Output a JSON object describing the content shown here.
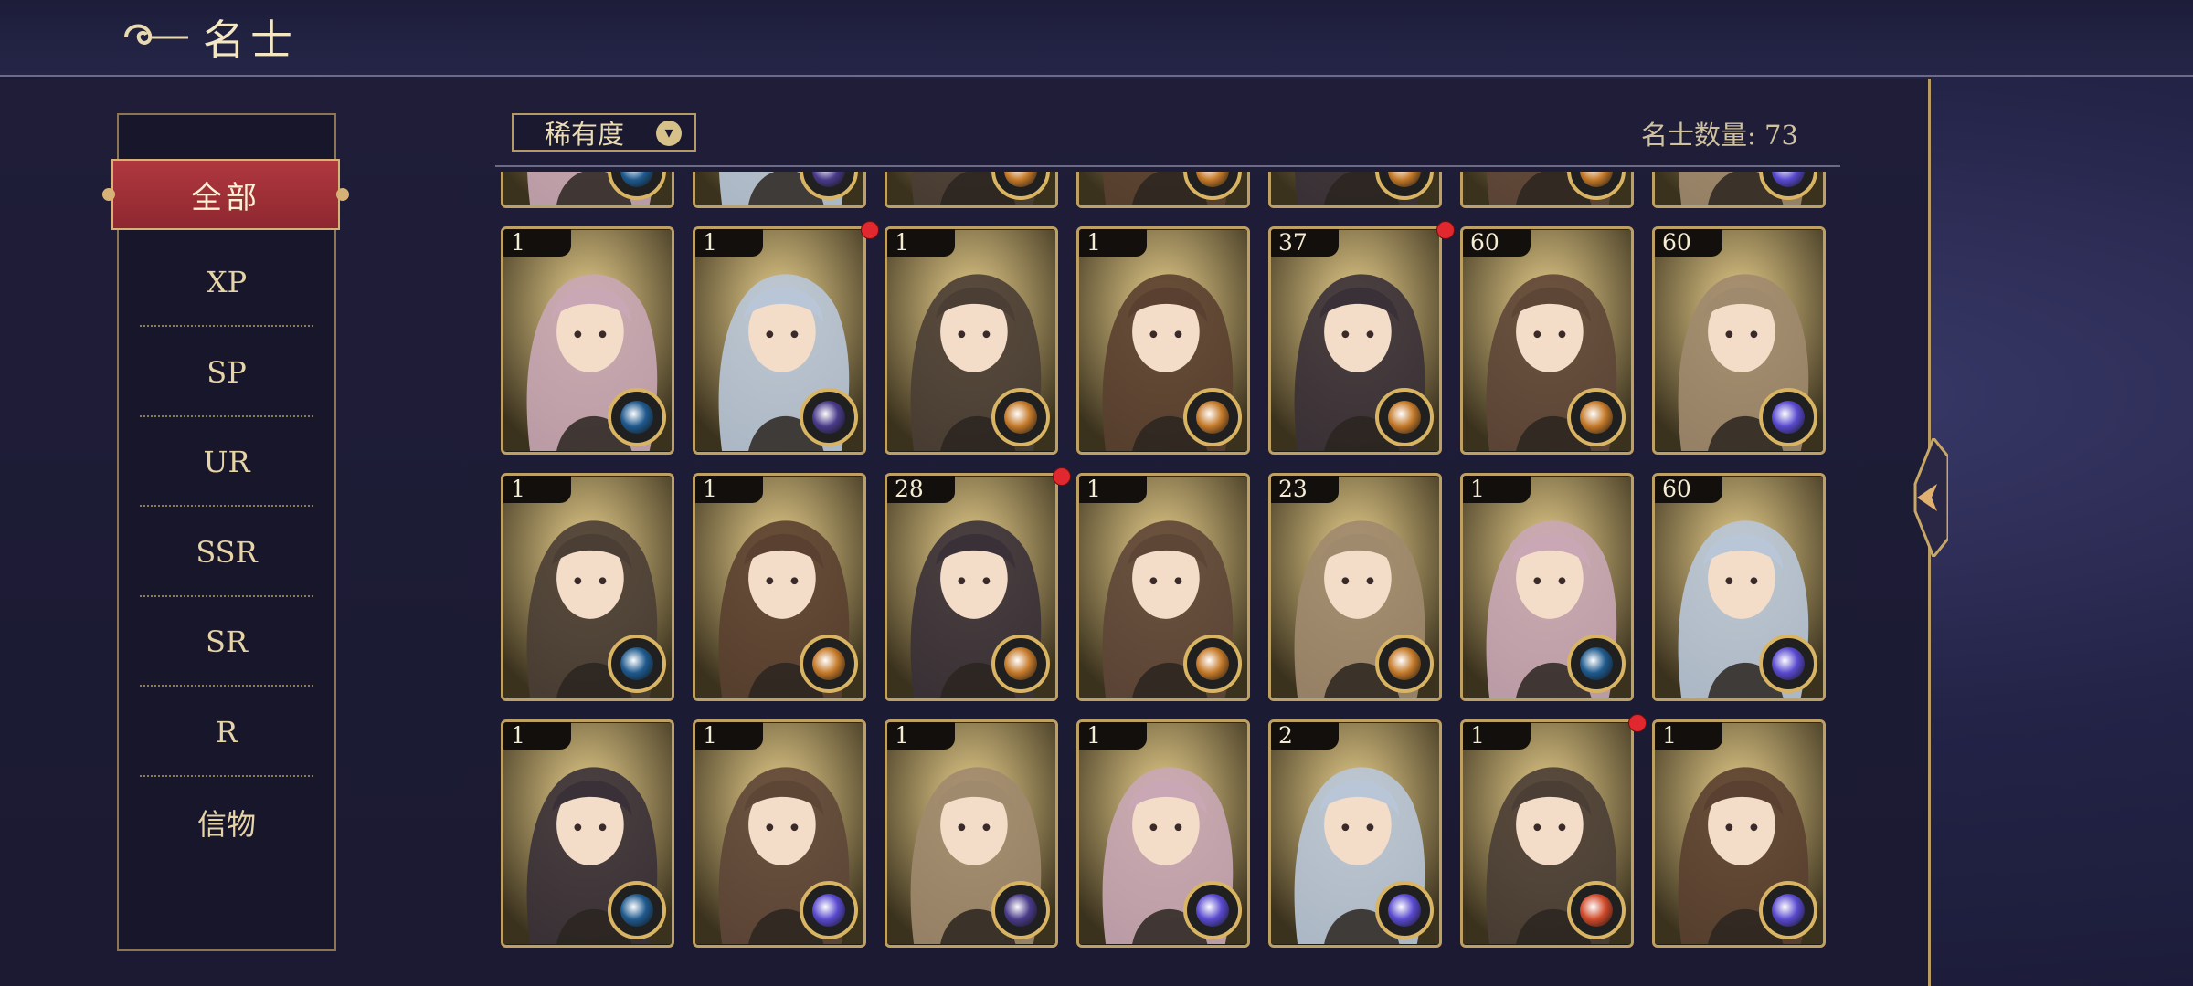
{
  "header": {
    "title": "名士"
  },
  "sidebar": {
    "active": "全部",
    "items": [
      "XP",
      "SP",
      "UR",
      "SSR",
      "SR",
      "R",
      "信物"
    ]
  },
  "filter": {
    "label": "稀有度"
  },
  "count_text": "名士数量: 73",
  "rows": [
    [
      {
        "level": "1",
        "emblem": "blue",
        "dot": false
      },
      {
        "level": "1",
        "emblem": "purple",
        "dot": true
      },
      {
        "level": "1",
        "emblem": "orange",
        "dot": false
      },
      {
        "level": "1",
        "emblem": "orange",
        "dot": false
      },
      {
        "level": "37",
        "emblem": "orange",
        "dot": true
      },
      {
        "level": "60",
        "emblem": "orange",
        "dot": false
      },
      {
        "level": "60",
        "emblem": "galaxy",
        "dot": false
      }
    ],
    [
      {
        "level": "1",
        "emblem": "blue",
        "dot": false
      },
      {
        "level": "1",
        "emblem": "orange",
        "dot": false
      },
      {
        "level": "28",
        "emblem": "orange",
        "dot": true
      },
      {
        "level": "1",
        "emblem": "orange",
        "dot": false
      },
      {
        "level": "23",
        "emblem": "orange",
        "dot": false
      },
      {
        "level": "1",
        "emblem": "blue",
        "dot": false
      },
      {
        "level": "60",
        "emblem": "galaxy",
        "dot": false
      }
    ],
    [
      {
        "level": "1",
        "emblem": "blue",
        "dot": false
      },
      {
        "level": "1",
        "emblem": "galaxy",
        "dot": false
      },
      {
        "level": "1",
        "emblem": "purple",
        "dot": false
      },
      {
        "level": "1",
        "emblem": "galaxy",
        "dot": false
      },
      {
        "level": "2",
        "emblem": "galaxy",
        "dot": false
      },
      {
        "level": "1",
        "emblem": "red",
        "dot": true
      },
      {
        "level": "1",
        "emblem": "galaxy",
        "dot": false
      }
    ]
  ],
  "emblem_colors": {
    "blue": "#1f5a8e",
    "purple": "#4a3b8a",
    "orange": "#c57a2a",
    "galaxy": "#5a4ad0",
    "red": "#d04a2a"
  },
  "portrait_tones": [
    "#c9a7b5",
    "#b9c6d8",
    "#4a3e35",
    "#5a4030",
    "#3a3138",
    "#5e4637",
    "#a08a6e"
  ]
}
